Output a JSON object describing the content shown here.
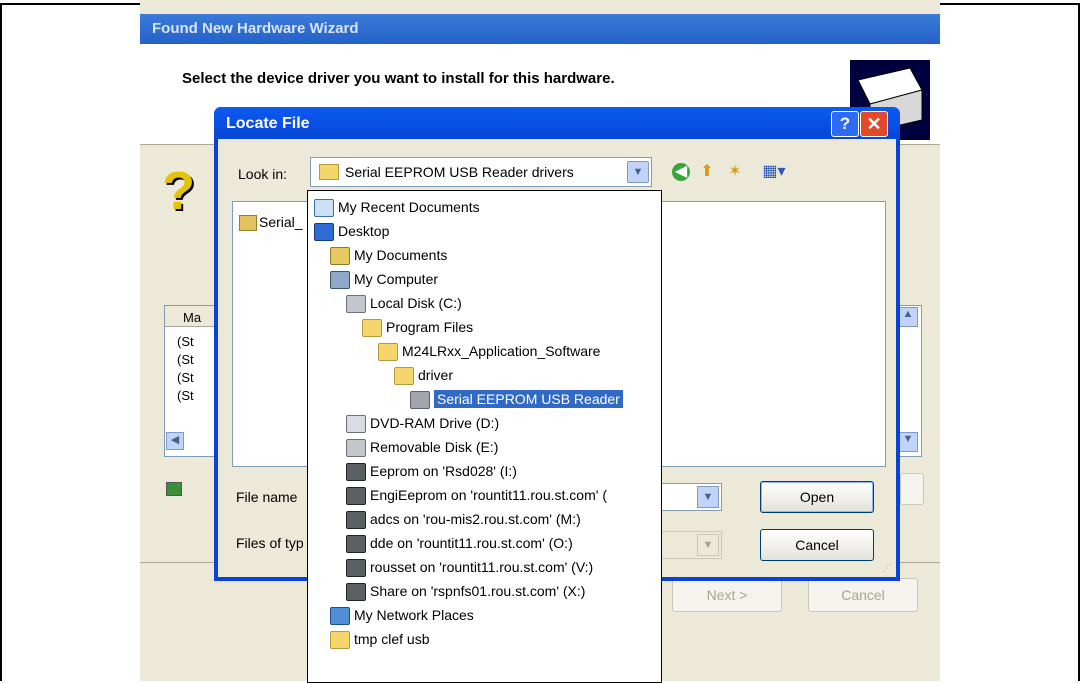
{
  "wizard": {
    "title": "Found New Hardware Wizard",
    "header_text": "Select the device driver you want to install for this hardware.",
    "list_header": "Ma",
    "list_rows": [
      "(St",
      "(St",
      "(St",
      "(St"
    ],
    "next_label": "Next >",
    "cancel_label": "Cancel"
  },
  "locate_file": {
    "title": "Locate File",
    "help_label": "?",
    "close_label": "✕",
    "look_in_label": "Look in:",
    "look_in_value": "Serial EEPROM USB Reader drivers",
    "file_item": "Serial_",
    "file_name_label": "File name",
    "files_of_type_label": "Files of typ",
    "open_label": "Open",
    "cancel_label": "Cancel"
  },
  "dropdown": {
    "items": [
      {
        "label": "My Recent Documents",
        "icon": "recent-documents-icon"
      },
      {
        "label": "Desktop",
        "icon": "desktop-icon"
      },
      {
        "label": "My Documents",
        "icon": "my-documents-icon"
      },
      {
        "label": "My Computer",
        "icon": "my-computer-icon"
      },
      {
        "label": "Local Disk (C:)",
        "icon": "local-disk-icon"
      },
      {
        "label": "Program Files",
        "icon": "folder-icon"
      },
      {
        "label": "M24LRxx_Application_Software",
        "icon": "folder-icon"
      },
      {
        "label": "driver",
        "icon": "folder-icon"
      },
      {
        "label": "Serial EEPROM USB Reader",
        "icon": "folder-open-icon",
        "selected": true
      },
      {
        "label": "DVD-RAM Drive (D:)",
        "icon": "dvd-drive-icon"
      },
      {
        "label": "Removable Disk (E:)",
        "icon": "removable-disk-icon"
      },
      {
        "label": "Eeprom on 'Rsd028' (I:)",
        "icon": "network-drive-icon"
      },
      {
        "label": "EngiEeprom on 'rountit11.rou.st.com' (",
        "icon": "network-drive-icon"
      },
      {
        "label": "adcs on 'rou-mis2.rou.st.com' (M:)",
        "icon": "network-drive-icon"
      },
      {
        "label": "dde on 'rountit11.rou.st.com' (O:)",
        "icon": "network-drive-icon"
      },
      {
        "label": "rousset on 'rountit11.rou.st.com' (V:)",
        "icon": "network-drive-icon"
      },
      {
        "label": "Share on 'rspnfs01.rou.st.com' (X:)",
        "icon": "network-drive-icon"
      },
      {
        "label": "My Network Places",
        "icon": "network-places-icon"
      },
      {
        "label": "tmp clef usb",
        "icon": "folder-icon"
      }
    ]
  },
  "colors": {
    "title_bar": "#0a5bf0",
    "selection": "#316ac5",
    "dialog_face": "#ece9d8"
  }
}
